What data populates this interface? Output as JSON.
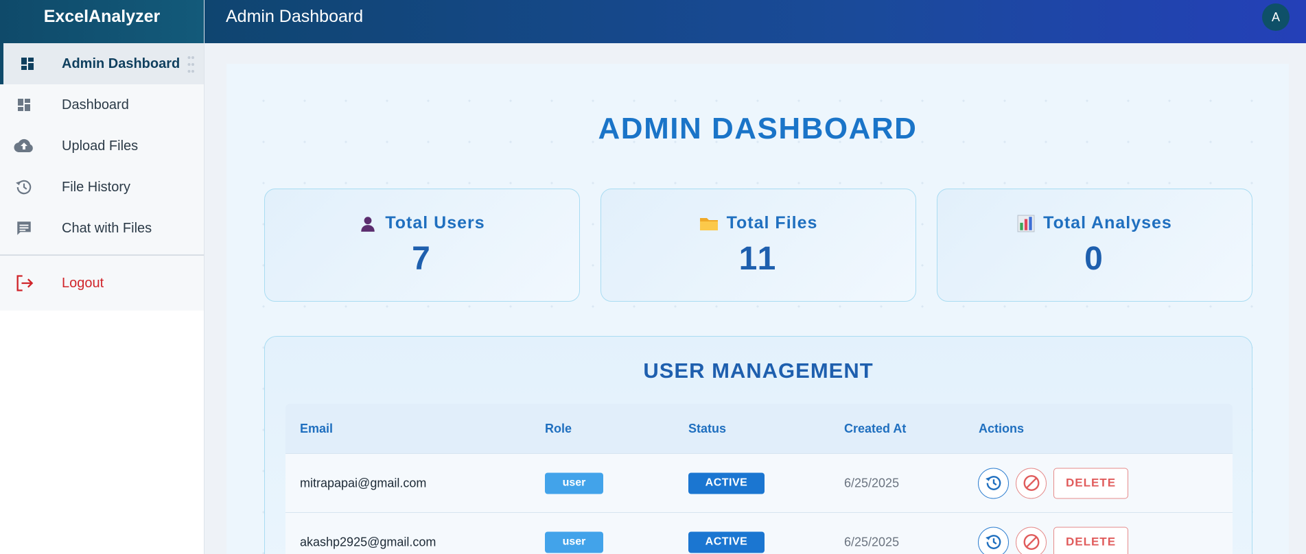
{
  "app": {
    "brand": "ExcelAnalyzer"
  },
  "header": {
    "title": "Admin Dashboard",
    "avatar_initial": "A"
  },
  "sidebar": {
    "items": [
      {
        "label": "Admin Dashboard",
        "icon": "dashboard-icon",
        "active": true
      },
      {
        "label": "Dashboard",
        "icon": "dashboard-icon"
      },
      {
        "label": "Upload Files",
        "icon": "cloud-upload-icon"
      },
      {
        "label": "File History",
        "icon": "history-icon"
      },
      {
        "label": "Chat with Files",
        "icon": "chat-icon"
      }
    ],
    "logout": {
      "label": "Logout",
      "icon": "logout-icon"
    }
  },
  "main": {
    "title": "ADMIN DASHBOARD",
    "stats": [
      {
        "label": "Total Users",
        "value": "7",
        "icon": "user-icon"
      },
      {
        "label": "Total Files",
        "value": "11",
        "icon": "folder-icon"
      },
      {
        "label": "Total Analyses",
        "value": "0",
        "icon": "bar-chart-icon"
      }
    ],
    "user_management": {
      "title": "USER MANAGEMENT",
      "columns": [
        "Email",
        "Role",
        "Status",
        "Created At",
        "Actions"
      ],
      "rows": [
        {
          "email": "mitrapapai@gmail.com",
          "role": "user",
          "status": "ACTIVE",
          "created_at": "6/25/2025",
          "delete_label": "DELETE"
        },
        {
          "email": "akashp2925@gmail.com",
          "role": "user",
          "status": "ACTIVE",
          "created_at": "6/25/2025",
          "delete_label": "DELETE"
        }
      ]
    }
  },
  "colors": {
    "accent": "#1a74c8",
    "sidebar_brand": "#0f4a6a",
    "logout": "#d0242a",
    "status_active": "#1b76d1",
    "role_user": "#42a3ea",
    "danger": "#e05b5b"
  }
}
